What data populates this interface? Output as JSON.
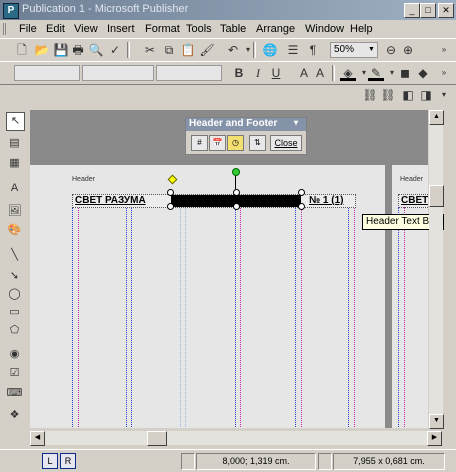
{
  "window": {
    "title": "Publication 1 - Microsoft Publisher",
    "app_icon_letter": "P",
    "minimize": "_",
    "maximize": "□",
    "close": "✕"
  },
  "menu": [
    "File",
    "Edit",
    "View",
    "Insert",
    "Format",
    "Tools",
    "Table",
    "Arrange",
    "Window",
    "Help"
  ],
  "toolbar": {
    "zoom": "50%"
  },
  "hf_toolbar": {
    "title": "Header and Footer",
    "close_label": "Close"
  },
  "page": {
    "header_label": "Header",
    "header_label_2": "Header",
    "header_text_left": "СВЕТ РАЗУМА",
    "header_text_right": "№ 1 (1)",
    "header_text_page2": "СВЕТ"
  },
  "tooltip": "Header Text Box",
  "status": {
    "page_left": "L",
    "page_right": "R",
    "position": "8,000; 1,319 cm.",
    "size": "7,955 x 0,681 cm."
  },
  "colors": {
    "title_bar": "#7d8ca1",
    "page_bg": "#e6e6e6",
    "workspace": "#8a8a8a",
    "guide_blue": "#2a3fd0",
    "guide_magenta": "#c02aa8"
  }
}
